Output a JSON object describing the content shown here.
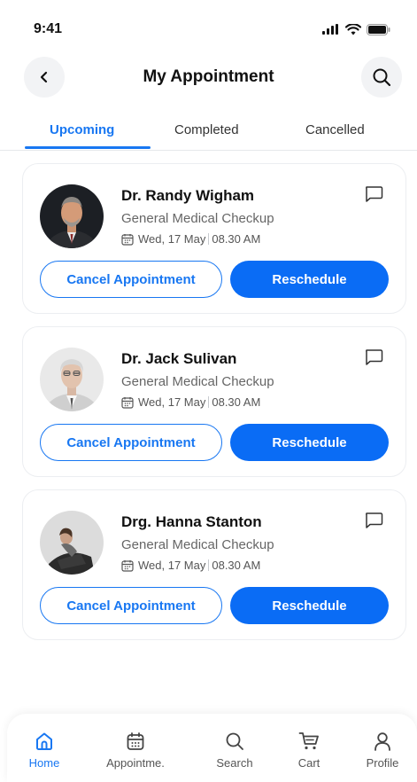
{
  "status_bar": {
    "time": "9:41"
  },
  "header": {
    "title": "My Appointment"
  },
  "tabs": [
    {
      "label": "Upcoming",
      "active": true
    },
    {
      "label": "Completed",
      "active": false
    },
    {
      "label": "Cancelled",
      "active": false
    }
  ],
  "appointments": [
    {
      "doctor": "Dr. Randy Wigham",
      "specialty": "General Medical Checkup",
      "date": "Wed, 17 May",
      "time": "08.30 AM",
      "cancel_label": "Cancel Appointment",
      "reschedule_label": "Reschedule"
    },
    {
      "doctor": "Dr. Jack Sulivan",
      "specialty": "General Medical Checkup",
      "date": "Wed, 17 May",
      "time": "08.30 AM",
      "cancel_label": "Cancel Appointment",
      "reschedule_label": "Reschedule"
    },
    {
      "doctor": "Drg. Hanna Stanton",
      "specialty": "General Medical Checkup",
      "date": "Wed, 17 May",
      "time": "08.30 AM",
      "cancel_label": "Cancel Appointment",
      "reschedule_label": "Reschedule"
    }
  ],
  "bottom_nav": [
    {
      "label": "Home",
      "icon": "home-icon",
      "active": true
    },
    {
      "label": "Appointme.",
      "icon": "calendar-icon",
      "active": false
    },
    {
      "label": "Search",
      "icon": "search-icon",
      "active": false
    },
    {
      "label": "Cart",
      "icon": "cart-icon",
      "active": false
    },
    {
      "label": "Profile",
      "icon": "profile-icon",
      "active": false
    }
  ],
  "colors": {
    "accent": "#1877f2",
    "button_primary": "#0a6cf5",
    "muted_text": "#666666"
  }
}
